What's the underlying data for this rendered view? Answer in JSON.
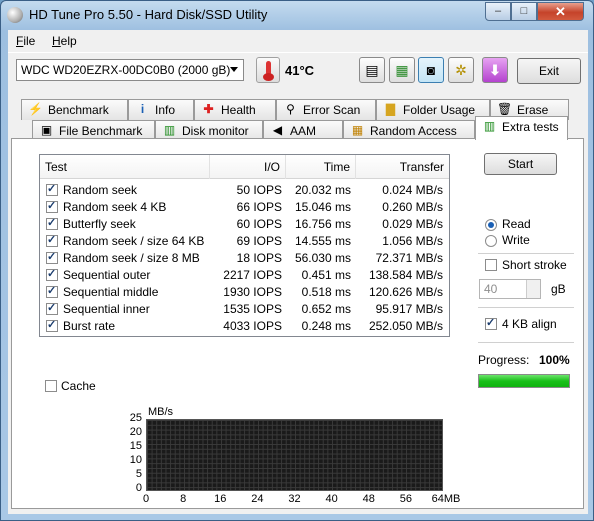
{
  "window": {
    "title": "HD Tune Pro 5.50 - Hard Disk/SSD Utility",
    "min": "–",
    "max": "□",
    "close": "✕"
  },
  "menu": {
    "file": "File",
    "help": "Help"
  },
  "toolbar": {
    "drive": "WDC WD20EZRX-00DC0B0 (2000 gB)",
    "temperature": "41°C",
    "exit": "Exit",
    "icons": [
      "copy-text-icon",
      "copy-window-icon",
      "screenshot-icon",
      "options-icon",
      "save-icon"
    ]
  },
  "tabs_top": [
    "Benchmark",
    "Info",
    "Health",
    "Error Scan",
    "Folder Usage",
    "Erase"
  ],
  "tabs_bottom": [
    "File Benchmark",
    "Disk monitor",
    "AAM",
    "Random Access",
    "Extra tests"
  ],
  "table": {
    "headers": [
      "Test",
      "I/O",
      "Time",
      "Transfer"
    ],
    "rows": [
      {
        "test": "Random seek",
        "io": "50 IOPS",
        "time": "20.032 ms",
        "transfer": "0.024 MB/s"
      },
      {
        "test": "Random seek 4 KB",
        "io": "66 IOPS",
        "time": "15.046 ms",
        "transfer": "0.260 MB/s"
      },
      {
        "test": "Butterfly seek",
        "io": "60 IOPS",
        "time": "16.756 ms",
        "transfer": "0.029 MB/s"
      },
      {
        "test": "Random seek / size 64 KB",
        "io": "69 IOPS",
        "time": "14.555 ms",
        "transfer": "1.056 MB/s"
      },
      {
        "test": "Random seek / size 8 MB",
        "io": "18 IOPS",
        "time": "56.030 ms",
        "transfer": "72.371 MB/s"
      },
      {
        "test": "Sequential outer",
        "io": "2217 IOPS",
        "time": "0.451 ms",
        "transfer": "138.584 MB/s"
      },
      {
        "test": "Sequential middle",
        "io": "1930 IOPS",
        "time": "0.518 ms",
        "transfer": "120.626 MB/s"
      },
      {
        "test": "Sequential inner",
        "io": "1535 IOPS",
        "time": "0.652 ms",
        "transfer": "95.917 MB/s"
      },
      {
        "test": "Burst rate",
        "io": "4033 IOPS",
        "time": "0.248 ms",
        "transfer": "252.050 MB/s"
      }
    ]
  },
  "side": {
    "start": "Start",
    "read": "Read",
    "write": "Write",
    "short_stroke": "Short stroke",
    "stroke_value": "40",
    "stroke_unit": "gB",
    "align": "4 KB align",
    "progress_label": "Progress:",
    "progress_value": "100%",
    "progress_fraction": 1.0
  },
  "cache": "Cache",
  "chart_data": {
    "type": "line",
    "ylabel": "MB/s",
    "xlabel": "MB",
    "y_ticks": [
      "25",
      "20",
      "15",
      "10",
      "5",
      "0"
    ],
    "x_ticks": [
      "0",
      "8",
      "16",
      "24",
      "32",
      "40",
      "48",
      "56",
      "64MB"
    ],
    "ylim": [
      0,
      25
    ],
    "xlim": [
      0,
      64
    ],
    "series": []
  }
}
